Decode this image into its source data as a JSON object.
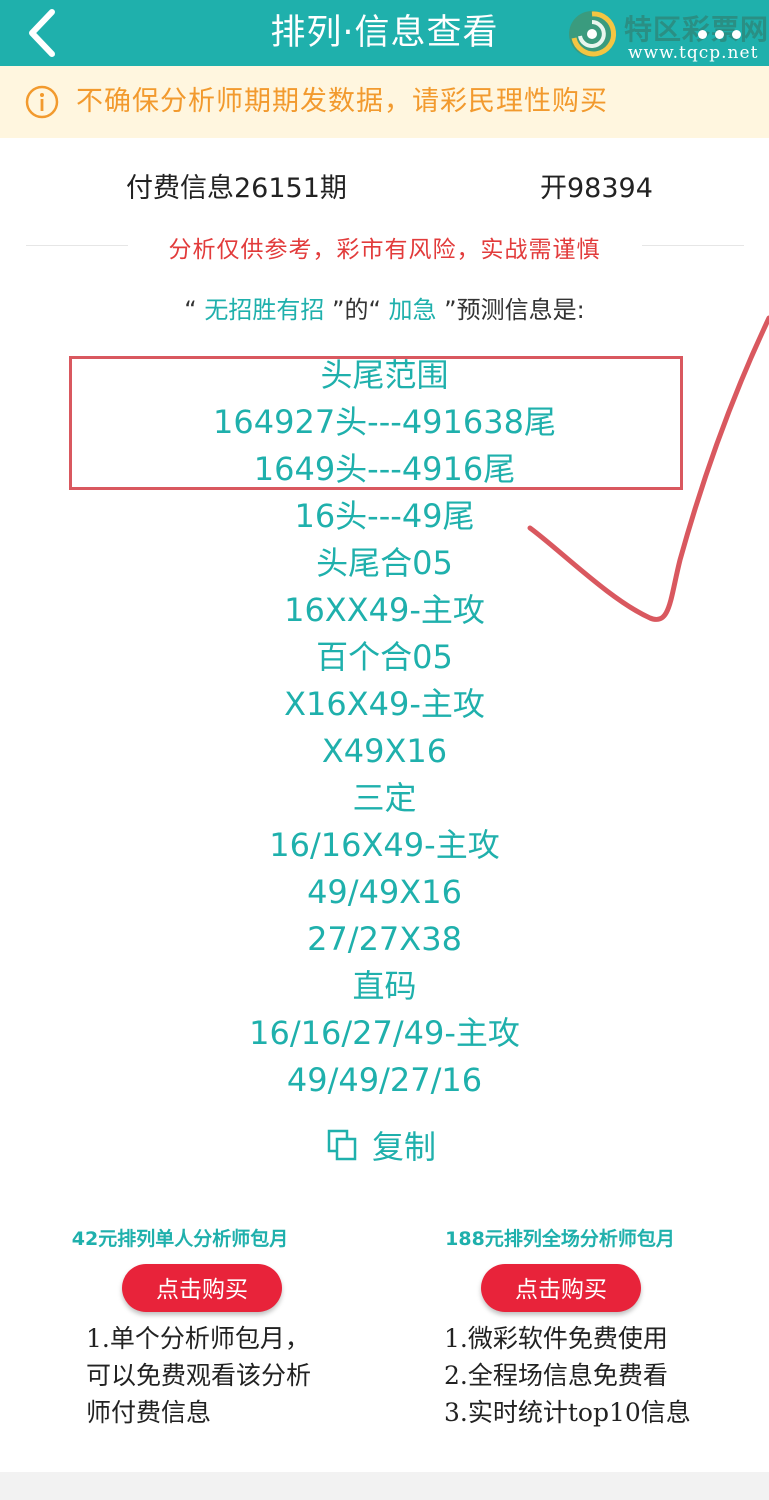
{
  "header": {
    "title": "排列·信息查看",
    "logo": {
      "name": "特区彩票网",
      "url": "www.tqcp.net",
      "icon": "swirl-logo-icon"
    },
    "back_icon": "chevron-left-icon"
  },
  "notice": {
    "icon": "info-circle-icon",
    "text": "不确保分析师期期发数据，请彩民理性购买"
  },
  "issue": {
    "title": "付费信息26151期",
    "open_result": "开98394"
  },
  "warning": "分析仅供参考，彩市有风险，实战需谨慎",
  "prediction_intro": {
    "quote_open_1": "“",
    "analyst": "无招胜有招",
    "quote_close_1": "”的“",
    "category": "加急",
    "quote_close_2": "”预测信息是:"
  },
  "predictions": [
    "头尾范围",
    "164927头---491638尾",
    "1649头---4916尾",
    "16头---49尾",
    "头尾合05",
    "16XX49-主攻",
    "百个合05",
    "X16X49-主攻",
    "X49X16",
    "三定",
    "16/16X49-主攻",
    "49/49X16",
    "27/27X38",
    "直码",
    "16/16/27/49-主攻",
    "49/49/27/16"
  ],
  "copy_button": {
    "label": "复制",
    "icon": "copy-icon"
  },
  "plans": [
    {
      "title": "42元排列单人分析师包月",
      "button": "点击购买",
      "desc": [
        "1.单个分析师包月，",
        "可以免费观看该分析",
        "师付费信息"
      ]
    },
    {
      "title": "188元排列全场分析师包月",
      "button": "点击购买",
      "desc": [
        "1.微彩软件免费使用",
        "2.全程场信息免费看",
        "3.实时统计top10信息"
      ]
    }
  ],
  "colors": {
    "primary": "#1fb0ac",
    "notice_bg": "#fff6df",
    "notice_text": "#f29a2e",
    "warning": "#e23b3b",
    "buy_button": "#e8233a",
    "annotation": "#d9585f"
  }
}
